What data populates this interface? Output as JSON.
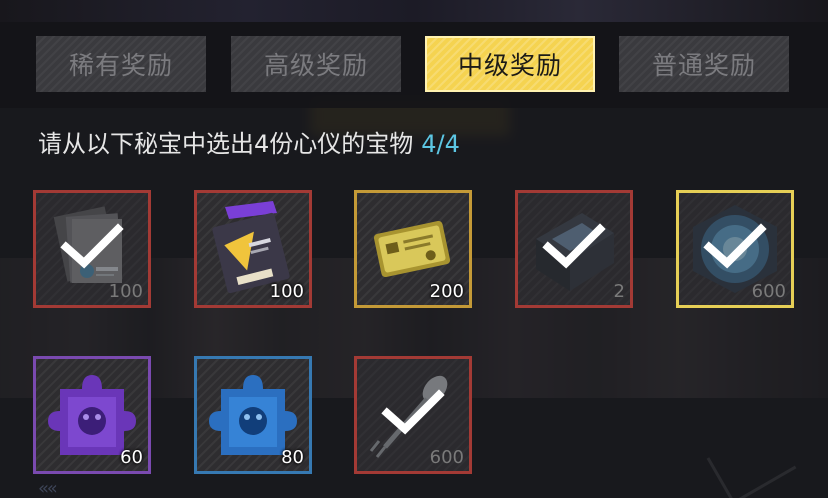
{
  "tabs": [
    {
      "label": "稀有奖励",
      "active": false
    },
    {
      "label": "高级奖励",
      "active": false
    },
    {
      "label": "中级奖励",
      "active": true
    },
    {
      "label": "普通奖励",
      "active": false
    }
  ],
  "instruction": {
    "text": "请从以下秘宝中选出4份心仪的宝物",
    "selected_count": "4/4"
  },
  "items": [
    {
      "name": "logs-document",
      "icon": "document-stack-icon",
      "quantity": "100",
      "selected": true,
      "frame_color": "#a33a35"
    },
    {
      "name": "purple-ticket",
      "icon": "ticket-card-icon",
      "quantity": "100",
      "selected": false,
      "frame_color": "#a33a35"
    },
    {
      "name": "gold-card",
      "icon": "gold-card-icon",
      "quantity": "200",
      "selected": false,
      "frame_color": "#c49a37"
    },
    {
      "name": "crystal-box",
      "icon": "crystal-box-icon",
      "quantity": "2",
      "selected": true,
      "frame_color": "#a33a35"
    },
    {
      "name": "blue-orb",
      "icon": "blue-orb-icon",
      "quantity": "600",
      "selected": true,
      "frame_color": "#e6cf56"
    },
    {
      "name": "purple-puzzle",
      "icon": "puzzle-piece-icon",
      "quantity": "60",
      "selected": false,
      "frame_color": "#7a4ab0"
    },
    {
      "name": "blue-puzzle",
      "icon": "puzzle-piece-icon",
      "quantity": "80",
      "selected": false,
      "frame_color": "#3679b2"
    },
    {
      "name": "spoon-fork",
      "icon": "spoon-fork-icon",
      "quantity": "600",
      "selected": true,
      "frame_color": "#a33a35"
    }
  ],
  "colors": {
    "active_tab": "#f5d350",
    "count_text": "#5cc6e3"
  }
}
